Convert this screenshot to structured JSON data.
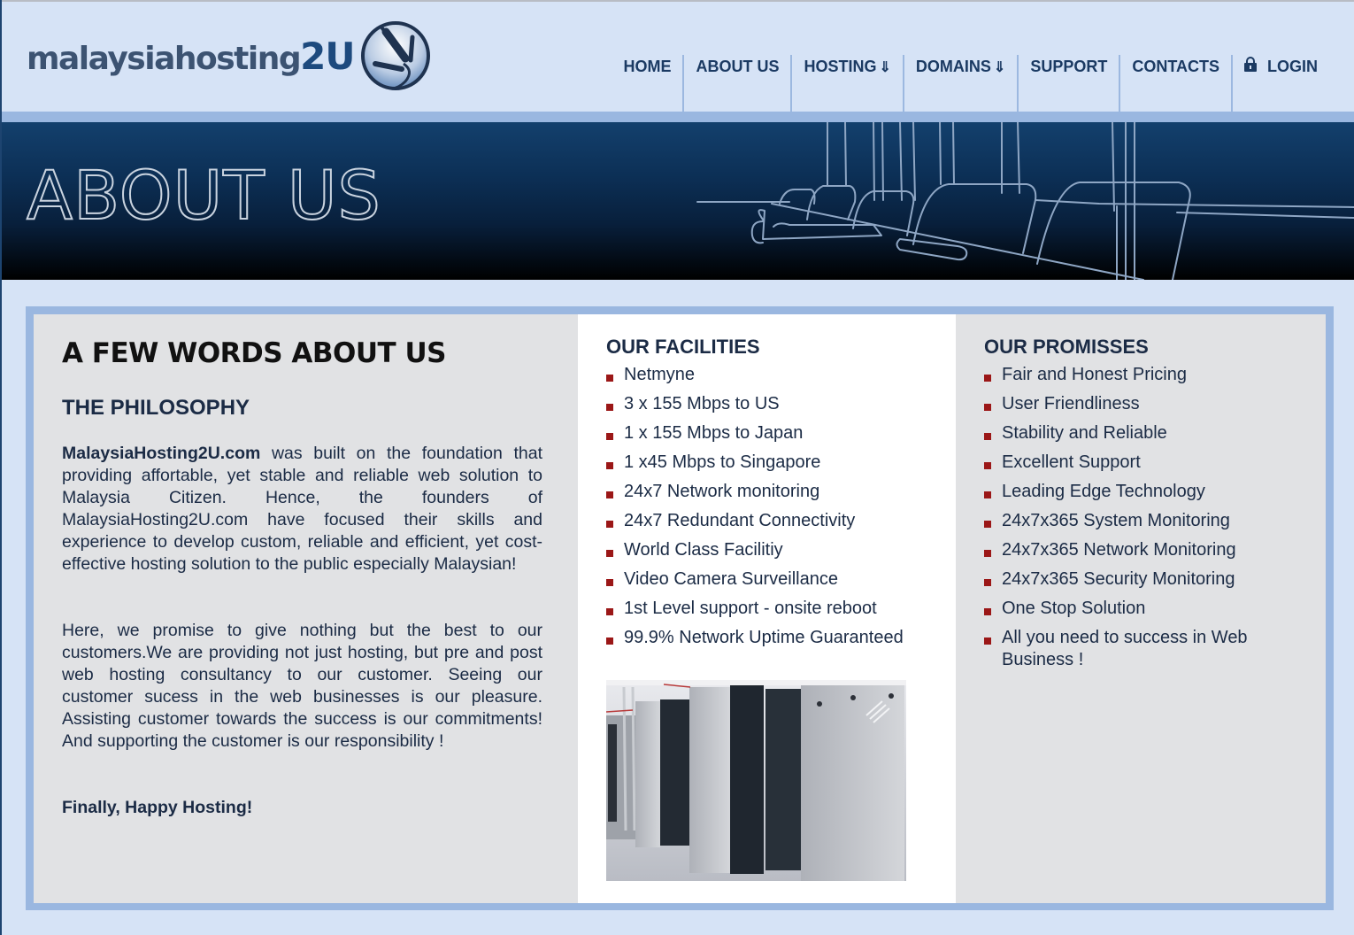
{
  "brand": {
    "logo_text": "malaysiahosting",
    "logo_text_suffix": "2U",
    "logo_icon": "cable-plug-icon"
  },
  "nav": {
    "items": [
      {
        "label": "HOME",
        "arrow": ""
      },
      {
        "label": "ABOUT US",
        "arrow": ""
      },
      {
        "label": "HOSTING",
        "arrow": "⇓"
      },
      {
        "label": "DOMAINS",
        "arrow": "⇓"
      },
      {
        "label": "SUPPORT",
        "arrow": ""
      },
      {
        "label": "CONTACTS",
        "arrow": ""
      },
      {
        "label": "LOGIN",
        "arrow": "",
        "icon": "lock-icon"
      }
    ]
  },
  "banner": {
    "title": "ABOUT US",
    "art": "conference-room-illustration"
  },
  "about": {
    "heading": "A FEW WORDS ABOUT US",
    "subheading": "THE PHILOSOPHY",
    "paragraph1_bold": "MalaysiaHosting2U.com",
    "paragraph1_rest": " was built on the foundation that providing affortable, yet stable and reliable web solution to Malaysia Citizen. Hence, the founders of MalaysiaHosting2U.com have focused their skills and experience to develop custom, reliable and efficient, yet cost-effective hosting solution to the public especially Malaysian!",
    "paragraph2": "Here, we promise to give nothing but the best to our customers.We are providing not just hosting, but pre and post web hosting consultancy to our customer. Seeing our customer sucess in the web businesses is our pleasure. Assisting customer towards the success is our commitments! And supporting the customer is our responsibility !",
    "closing": "Finally, Happy Hosting!"
  },
  "facilities": {
    "heading": "OUR FACILITIES",
    "items": [
      "Netmyne",
      "3 x 155 Mbps to US",
      "1 x 155 Mbps to Japan",
      "1 x45 Mbps to Singapore",
      "24x7 Network monitoring",
      "24x7 Redundant Connectivity",
      "World Class Facilitiy",
      "Video Camera Surveillance",
      "1st Level support - onsite reboot",
      "99.9% Network Uptime Guaranteed"
    ],
    "photo": "server-racks-photo"
  },
  "promises": {
    "heading": "OUR PROMISSES",
    "items": [
      "Fair and Honest Pricing",
      "User Friendliness",
      "Stability and Reliable",
      "Excellent Support",
      "Leading Edge Technology",
      "24x7x365 System Monitoring",
      "24x7x365 Network Monitoring",
      "24x7x365 Security Monitoring",
      "One Stop Solution",
      "All you need to success in Web Business !"
    ]
  },
  "colors": {
    "page_bg": "#d6e3f6",
    "accent_band": "#9ab7e0",
    "nav_text": "#1b3a63",
    "bullet": "#9b1717",
    "panel_gray": "#e1e2e4"
  }
}
